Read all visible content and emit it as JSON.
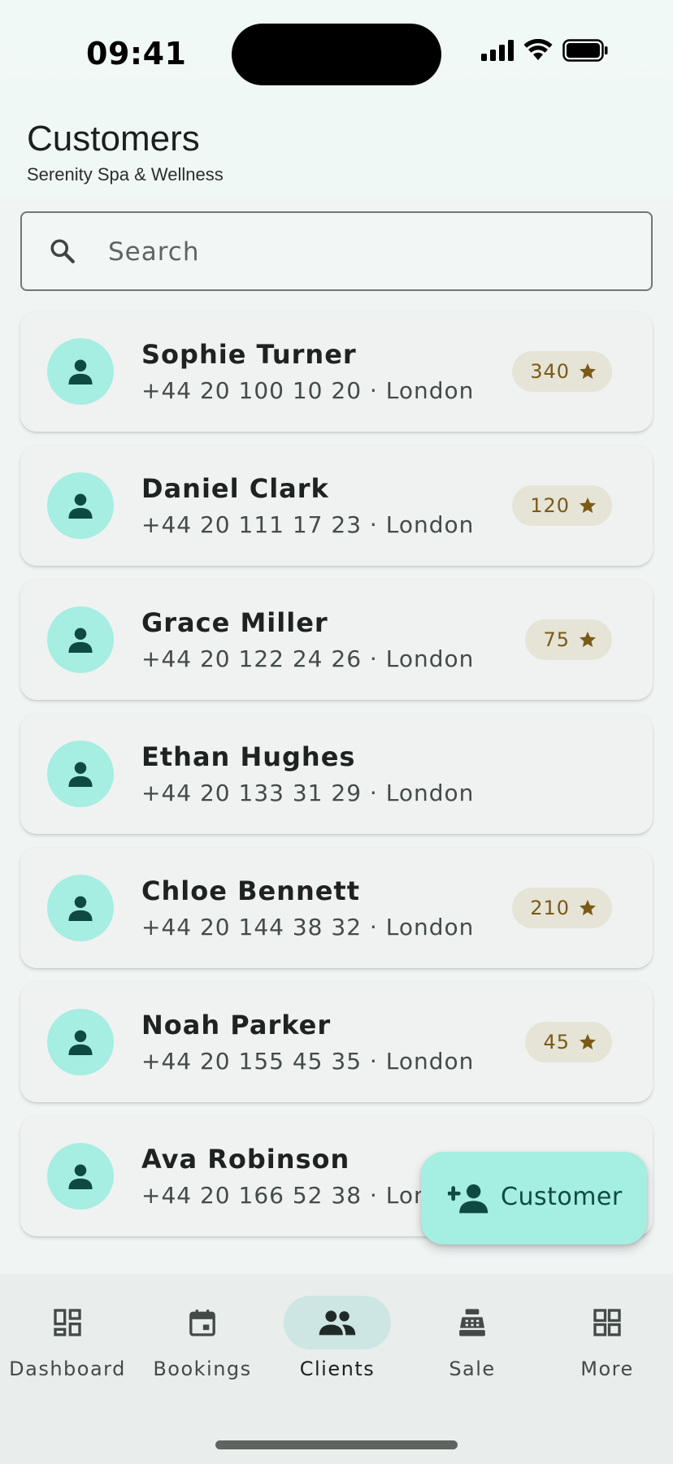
{
  "status_bar": {
    "time": "09:41"
  },
  "header": {
    "title": "Customers",
    "subtitle": "Serenity Spa & Wellness"
  },
  "search": {
    "placeholder": "Search",
    "value": ""
  },
  "clients": [
    {
      "name": "Sophie Turner",
      "meta": "+44 20 100 10 20 · London",
      "points": "340"
    },
    {
      "name": "Daniel Clark",
      "meta": "+44 20 111 17 23 · London",
      "points": "120"
    },
    {
      "name": "Grace Miller",
      "meta": "+44 20 122 24 26 · London",
      "points": "75"
    },
    {
      "name": "Ethan Hughes",
      "meta": "+44 20 133 31 29 · London",
      "points": ""
    },
    {
      "name": "Chloe Bennett",
      "meta": "+44 20 144 38 32 · London",
      "points": "210"
    },
    {
      "name": "Noah Parker",
      "meta": "+44 20 155 45 35 · London",
      "points": "45"
    },
    {
      "name": "Ava Robinson",
      "meta": "+44 20 166 52 38 · London",
      "points": ""
    }
  ],
  "fab": {
    "label": "Customer",
    "icon": "person-add-icon"
  },
  "nav": {
    "items": [
      {
        "label": "Dashboard",
        "icon": "dashboard-icon",
        "active": false
      },
      {
        "label": "Bookings",
        "icon": "calendar-icon",
        "active": false
      },
      {
        "label": "Clients",
        "icon": "people-icon",
        "active": true
      },
      {
        "label": "Sale",
        "icon": "cash-register-icon",
        "active": false
      },
      {
        "label": "More",
        "icon": "grid-icon",
        "active": false
      }
    ]
  },
  "colors": {
    "accent": "#a6ede2",
    "accent_dark": "#0f4a41",
    "badge_bg": "#e5e4d6",
    "badge_text": "#7b5a18"
  }
}
